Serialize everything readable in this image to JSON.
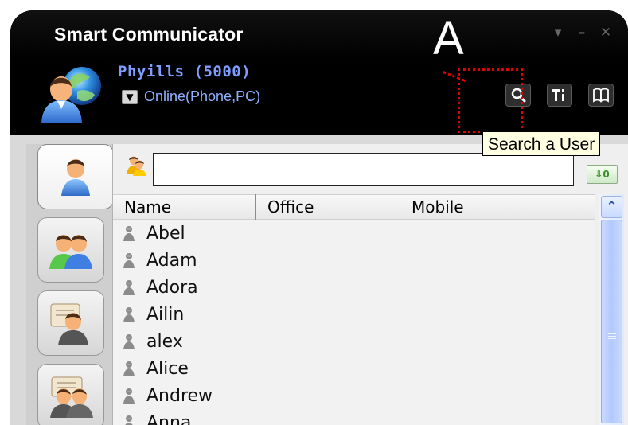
{
  "app": {
    "title": "Smart Communicator"
  },
  "user": {
    "name": "Phyills (5000)",
    "status": "Online(Phone,PC)"
  },
  "annotation": {
    "label": "A"
  },
  "toolbar": {
    "search_tooltip": "Search a User"
  },
  "search": {
    "value": "",
    "placeholder": ""
  },
  "table": {
    "columns": [
      "Name",
      "Office",
      "Mobile"
    ],
    "rows": [
      "Abel",
      "Adam",
      "Adora",
      "Ailin",
      "alex",
      "Alice",
      "Andrew",
      "Anna"
    ]
  },
  "icons": {
    "minimize": "minimize-icon",
    "restore": "dash-icon",
    "close": "close-icon",
    "search": "search-icon",
    "tools": "tools-icon",
    "book": "book-icon"
  },
  "colors": {
    "accent_blue": "#7f9cff",
    "annotation_red": "#e30000",
    "tooltip_bg": "#ffffe1"
  }
}
